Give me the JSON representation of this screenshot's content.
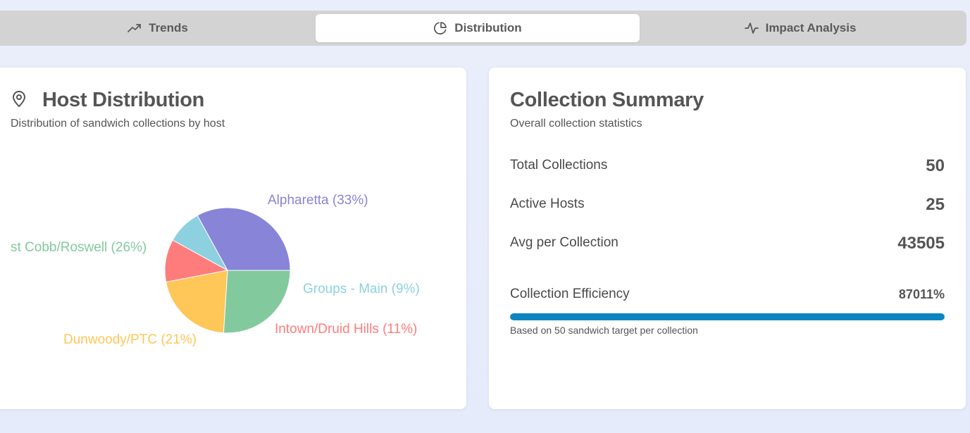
{
  "tabs": [
    {
      "label": "Trends",
      "icon": "trending-up-icon",
      "active": false
    },
    {
      "label": "Distribution",
      "icon": "pie-chart-icon",
      "active": true
    },
    {
      "label": "Impact Analysis",
      "icon": "activity-icon",
      "active": false
    }
  ],
  "host_card": {
    "title": "Host Distribution",
    "subtitle": "Distribution of sandwich collections by host",
    "icon": "map-pin-icon"
  },
  "chart_data": {
    "type": "pie",
    "slices": [
      {
        "name": "Alpharetta",
        "value": 33,
        "label": "Alpharetta (33%)",
        "color": "#8884d8"
      },
      {
        "name": "Groups - Main",
        "value": 9,
        "label": "Groups - Main (9%)",
        "color": "#8dd1e1"
      },
      {
        "name": "Intown/Druid Hills",
        "value": 11,
        "label": "Intown/Druid Hills (11%)",
        "color": "#ff7c7c"
      },
      {
        "name": "Dunwoody/PTC",
        "value": 21,
        "label": "Dunwoody/PTC (21%)",
        "color": "#ffc658"
      },
      {
        "name": "st Cobb/Roswell",
        "value": 26,
        "label": "st Cobb/Roswell (26%)",
        "color": "#82ca9d"
      }
    ]
  },
  "summary_card": {
    "title": "Collection Summary",
    "subtitle": "Overall collection statistics",
    "stats": [
      {
        "label": "Total Collections",
        "value": "50"
      },
      {
        "label": "Active Hosts",
        "value": "25"
      },
      {
        "label": "Avg per Collection",
        "value": "43505"
      }
    ],
    "efficiency": {
      "label": "Collection Efficiency",
      "value": "87011%",
      "fill_fraction": 1.0,
      "note": "Based on 50 sandwich target per collection"
    }
  },
  "colors": {
    "accent": "#0a85c0",
    "tabbar": "#d3d3d3"
  }
}
